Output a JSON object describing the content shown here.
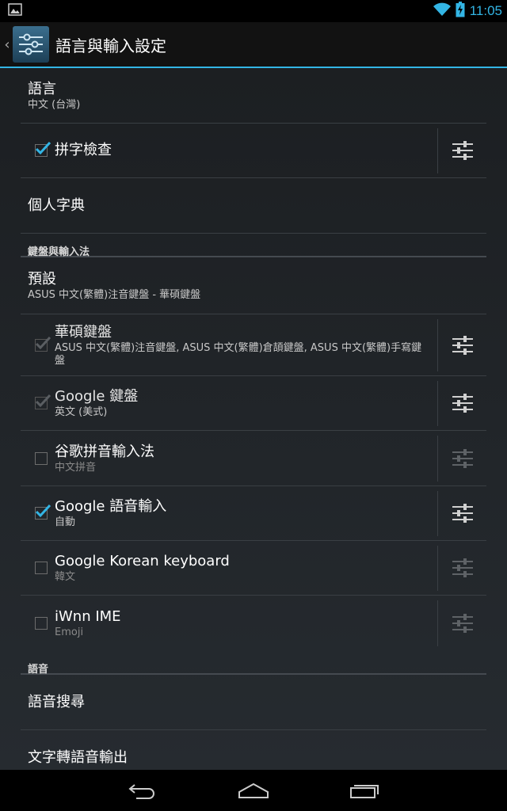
{
  "status_bar": {
    "time": "11:05",
    "icons": [
      "image-notification-icon",
      "wifi-icon",
      "battery-charging-icon"
    ]
  },
  "action_bar": {
    "title": "語言與輸入設定",
    "icon": "settings-sliders-icon"
  },
  "colors": {
    "accent": "#33b5e5",
    "background": "#1c1f22",
    "divider": "#3a3f44"
  },
  "language": {
    "title": "語言",
    "summary": "中文 (台灣)"
  },
  "spell_check": {
    "title": "拼字檢查",
    "checked": true
  },
  "personal_dictionary": {
    "title": "個人字典"
  },
  "keyboards_section": {
    "header": "鍵盤與輸入法",
    "default": {
      "title": "預設",
      "summary": "ASUS 中文(繁體)注音鍵盤 - 華碩鍵盤"
    },
    "items": [
      {
        "title": "華碩鍵盤",
        "summary": "ASUS 中文(繁體)注音鍵盤, ASUS 中文(繁體)倉頡鍵盤, ASUS 中文(繁體)手寫鍵盤",
        "checked": true,
        "enabled": false
      },
      {
        "title": "Google 鍵盤",
        "summary": "英文 (美式)",
        "checked": true,
        "enabled": false
      },
      {
        "title": "谷歌拼音輸入法",
        "summary": "中文拼音",
        "checked": false,
        "enabled": true
      },
      {
        "title": "Google 語音輸入",
        "summary": "自動",
        "checked": true,
        "enabled": true
      },
      {
        "title": "Google Korean keyboard",
        "summary": "韓文",
        "checked": false,
        "enabled": true
      },
      {
        "title": "iWnn IME",
        "summary": "Emoji",
        "checked": false,
        "enabled": true
      }
    ]
  },
  "speech_section": {
    "header": "語音",
    "voice_search": {
      "title": "語音搜尋"
    },
    "tts_output": {
      "title": "文字轉語音輸出"
    }
  },
  "nav_bar": {
    "buttons": [
      "back-icon",
      "home-icon",
      "recent-apps-icon"
    ]
  }
}
